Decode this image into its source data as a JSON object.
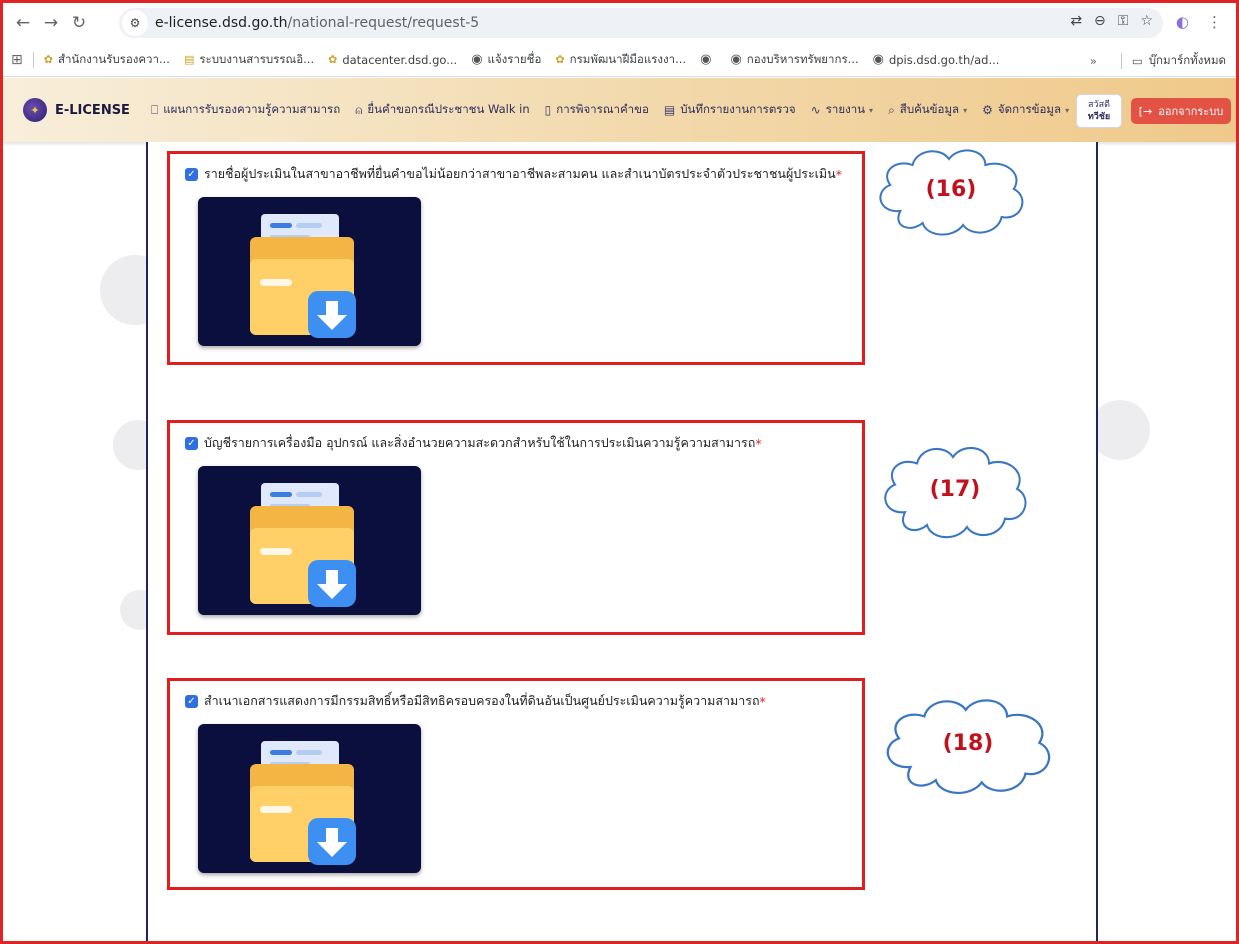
{
  "browser": {
    "url_host": "e-license.dsd.go.th",
    "url_path": "/national-request/request-5",
    "bookmarks": [
      {
        "label": "สำนักงานรับรองควา...",
        "icon": "dsd-logo-icon"
      },
      {
        "label": "ระบบงานสารบรรณอิ...",
        "icon": "doc-icon"
      },
      {
        "label": "datacenter.dsd.go...",
        "icon": "dsd-logo-icon"
      },
      {
        "label": "แจ้งรายชื่อ",
        "icon": "globe-icon"
      },
      {
        "label": "กรมพัฒนาฝีมือแรงงา...",
        "icon": "dsd-logo-icon"
      },
      {
        "label": "",
        "icon": "globe-icon"
      },
      {
        "label": "กองบริหารทรัพยากร...",
        "icon": "globe-icon"
      },
      {
        "label": "dpis.dsd.go.th/ad...",
        "icon": "globe-icon"
      }
    ],
    "more_label": "»",
    "all_bookmarks_label": "บุ๊กมาร์กทั้งหมด"
  },
  "app": {
    "logo_text": "E-LICENSE",
    "menu": [
      {
        "label": "แผนการรับรองความรู้ความสามารถ",
        "icon": "book-icon",
        "dropdown": false
      },
      {
        "label": "ยื่นคำขอกรณีประชาชน Walk in",
        "icon": "user-add-icon",
        "dropdown": false
      },
      {
        "label": "การพิจารณาคำขอ",
        "icon": "clipboard-icon",
        "dropdown": false
      },
      {
        "label": "บันทึกรายงานการตรวจ",
        "icon": "document-icon",
        "dropdown": false
      },
      {
        "label": "รายงาน",
        "icon": "activity-icon",
        "dropdown": true
      },
      {
        "label": "สืบค้นข้อมูล",
        "icon": "search-icon",
        "dropdown": true
      },
      {
        "label": "จัดการข้อมูล",
        "icon": "gear-icon",
        "dropdown": true
      }
    ],
    "greeting_line1": "สวัสดี",
    "greeting_line2": "ทวีชัย",
    "logout_label": "ออกจากระบบ"
  },
  "sections": [
    {
      "title": "รายชื่อผู้ประเมินในสาขาอาชีพที่ยื่นคำขอไม่น้อยกว่าสาขาอาชีพละสามคน และสำเนาบัตรประจำตัวประชาชนผู้ประเมิน",
      "required_mark": "*",
      "checked": true,
      "callout": "(16)"
    },
    {
      "title": "บัญชีรายการเครื่องมือ อุปกรณ์ และสิ่งอำนวยความสะดวกสำหรับใช้ในการประเมินความรู้ความสามารถ",
      "required_mark": "*",
      "checked": true,
      "callout": "(17)"
    },
    {
      "title": "สำเนาเอกสารแสดงการมีกรรมสิทธิ์หรือมีสิทธิครอบครองในที่ดินอันเป็นศูนย์ประเมินความรู้ความสามารถ",
      "required_mark": "*",
      "checked": true,
      "callout": "(18)"
    }
  ],
  "colors": {
    "highlight_border": "#e01e1e",
    "callout_text": "#c0121e",
    "thumb_bg": "#0b0f3d",
    "logout_bg": "#e25245"
  }
}
